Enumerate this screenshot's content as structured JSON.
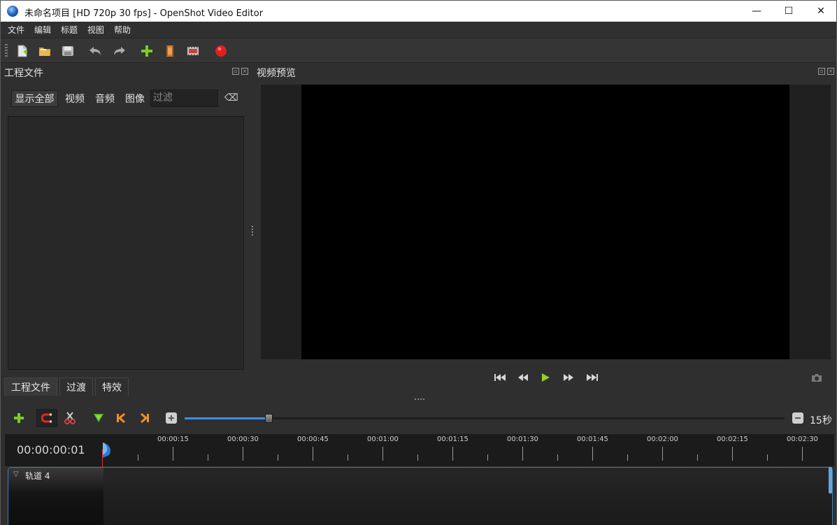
{
  "window": {
    "title": "未命名项目 [HD 720p 30 fps] - OpenShot Video Editor",
    "minimize": "—",
    "maximize": "☐",
    "close": "✕"
  },
  "menu": [
    "文件",
    "编辑",
    "标题",
    "视图",
    "帮助"
  ],
  "toolbar_icons": [
    "new-project-icon",
    "open-project-icon",
    "save-project-icon",
    "undo-icon",
    "redo-icon",
    "import-files-icon",
    "profile-icon",
    "fullscreen-icon",
    "export-video-icon"
  ],
  "project_files": {
    "title": "工程文件",
    "filters": [
      "显示全部",
      "视频",
      "音频",
      "图像"
    ],
    "filter_placeholder": "过滤",
    "clear_icon": "⌫"
  },
  "bottom_tabs": [
    "工程文件",
    "过渡",
    "特效"
  ],
  "preview": {
    "title": "视频预览"
  },
  "playback_icons": [
    "jump-start-icon",
    "rewind-icon",
    "play-icon",
    "fast-forward-icon",
    "jump-end-icon",
    "snapshot-icon"
  ],
  "timeline": {
    "toolbar_icons": [
      "add-track-icon",
      "snap-icon",
      "razor-icon",
      "add-marker-icon",
      "previous-marker-icon",
      "next-marker-icon"
    ],
    "zoom_label": "15秒",
    "zoom_level": 0.14,
    "timecode": "00:00:00:01",
    "ruler_labels": [
      "00:00:15",
      "00:00:30",
      "00:00:45",
      "00:01:00",
      "00:01:15",
      "00:01:30",
      "00:01:45",
      "00:02:00",
      "00:02:15",
      "00:02:30"
    ],
    "track_name": "轨道 4"
  },
  "colors": {
    "background": "#2f2f2f",
    "accent": "#3d8fe8",
    "playhead": "#e23030",
    "add_icon": "#7fcc1f",
    "marker_orange": "#f0902a"
  }
}
